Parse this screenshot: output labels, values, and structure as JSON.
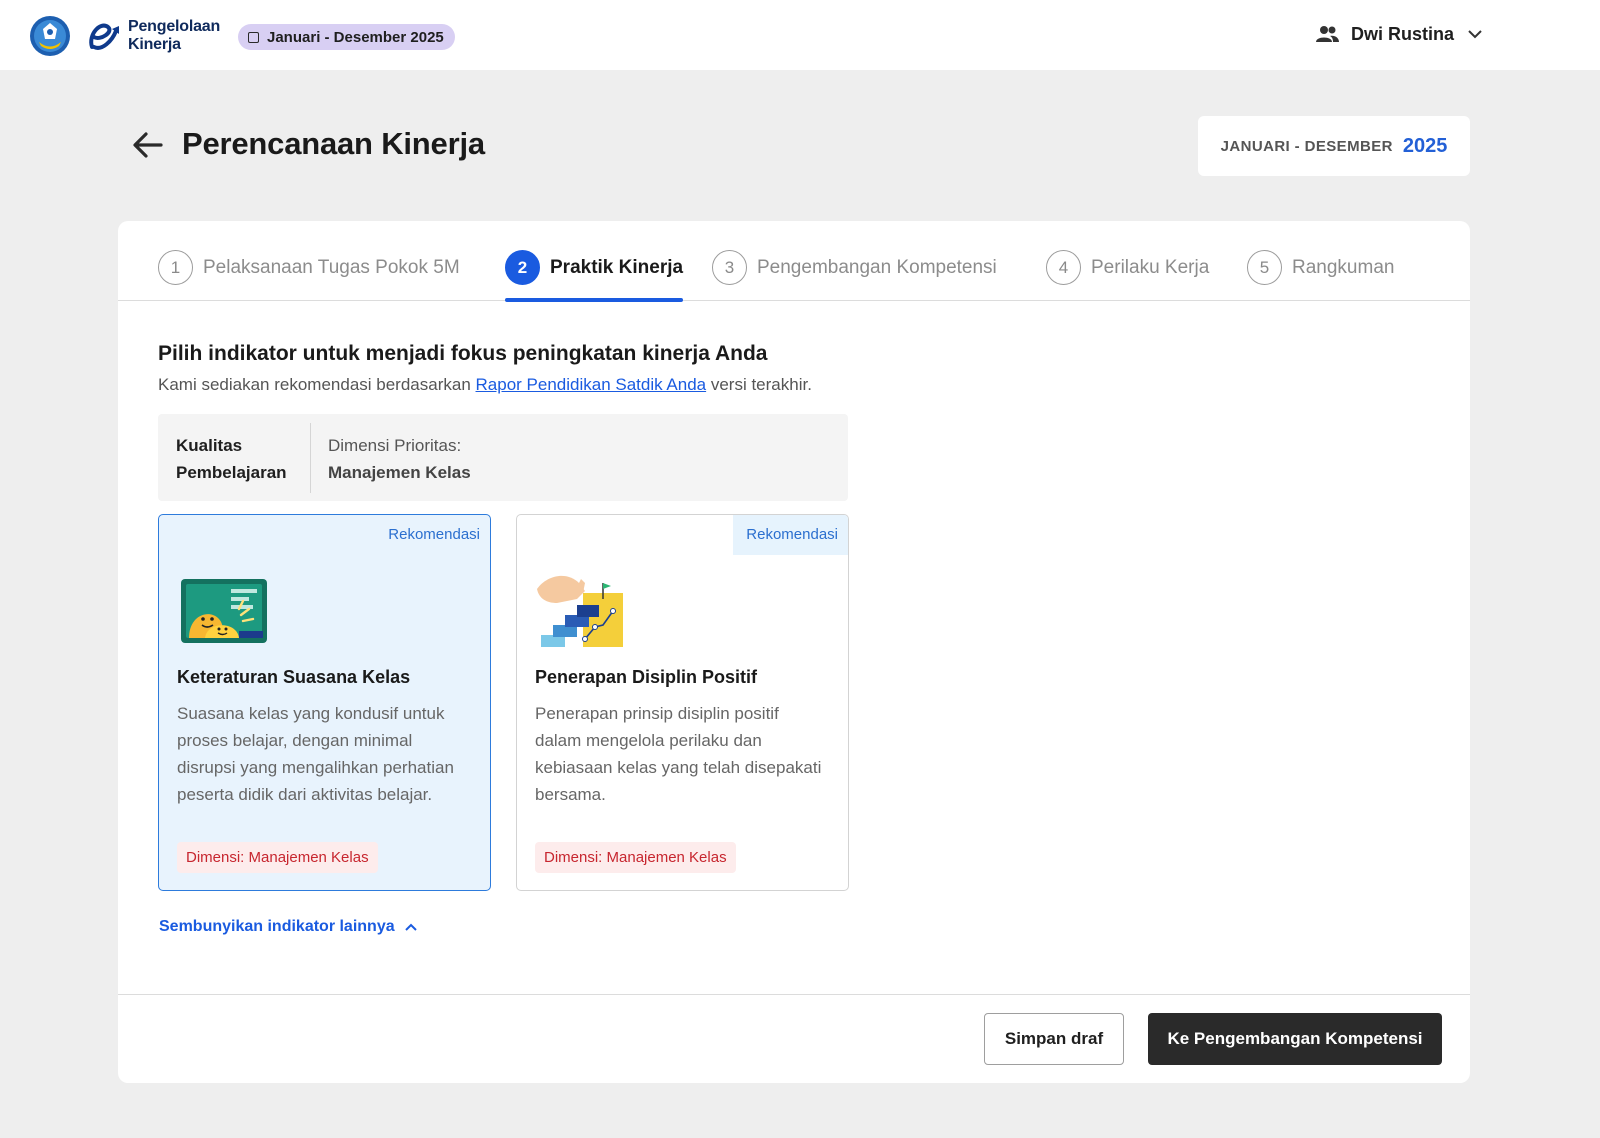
{
  "header": {
    "brand_line1": "Pengelolaan",
    "brand_line2": "Kinerja",
    "period_chip": "Januari - Desember 2025",
    "user_name": "Dwi Rustina"
  },
  "page": {
    "title": "Perencanaan Kinerja",
    "period_label": "JANUARI - DESEMBER",
    "period_year": "2025"
  },
  "tabs": [
    {
      "num": "1",
      "label": "Pelaksanaan Tugas Pokok 5M",
      "active": false
    },
    {
      "num": "2",
      "label": "Praktik Kinerja",
      "active": true
    },
    {
      "num": "3",
      "label": "Pengembangan Kompetensi",
      "active": false
    },
    {
      "num": "4",
      "label": "Perilaku Kerja",
      "active": false
    },
    {
      "num": "5",
      "label": "Rangkuman",
      "active": false
    }
  ],
  "section": {
    "title": "Pilih indikator untuk menjadi fokus peningkatan kinerja Anda",
    "subtitle_before": "Kami sediakan rekomendasi berdasarkan ",
    "subtitle_link": "Rapor Pendidikan Satdik Anda",
    "subtitle_after": " versi terakhir."
  },
  "dimension_box": {
    "category_line1": "Kualitas",
    "category_line2": "Pembelajaran",
    "priority_label": "Dimensi Prioritas:",
    "priority_value": "Manajemen Kelas"
  },
  "indicators": [
    {
      "tag": "Rekomendasi",
      "title": "Keteraturan Suasana Kelas",
      "description": "Suasana kelas yang kondusif untuk proses belajar, dengan minimal disrupsi yang mengalihkan perhatian peserta didik dari aktivitas belajar.",
      "dimension": "Dimensi: Manajemen Kelas",
      "selected": true
    },
    {
      "tag": "Rekomendasi",
      "title": "Penerapan Disiplin Positif",
      "description": "Penerapan prinsip disiplin positif dalam mengelola perilaku dan kebiasaan kelas yang telah disepakati bersama.",
      "dimension": "Dimensi: Manajemen Kelas",
      "selected": false
    }
  ],
  "toggle_link": "Sembunyikan indikator lainnya",
  "footer": {
    "draft_button": "Simpan draf",
    "next_button": "Ke Pengembangan Kompetensi"
  },
  "colors": {
    "primary": "#1a5be0",
    "selected_card_bg": "#e8f3fd",
    "dimension_text": "#c7262f",
    "chip_bg": "#d8cff3"
  },
  "icons": [
    "kemendikbud-emblem-icon",
    "pengelolaan-kinerja-logo-icon",
    "calendar-icon",
    "users-icon",
    "chevron-down-icon",
    "arrow-left-icon",
    "chevron-up-icon"
  ]
}
